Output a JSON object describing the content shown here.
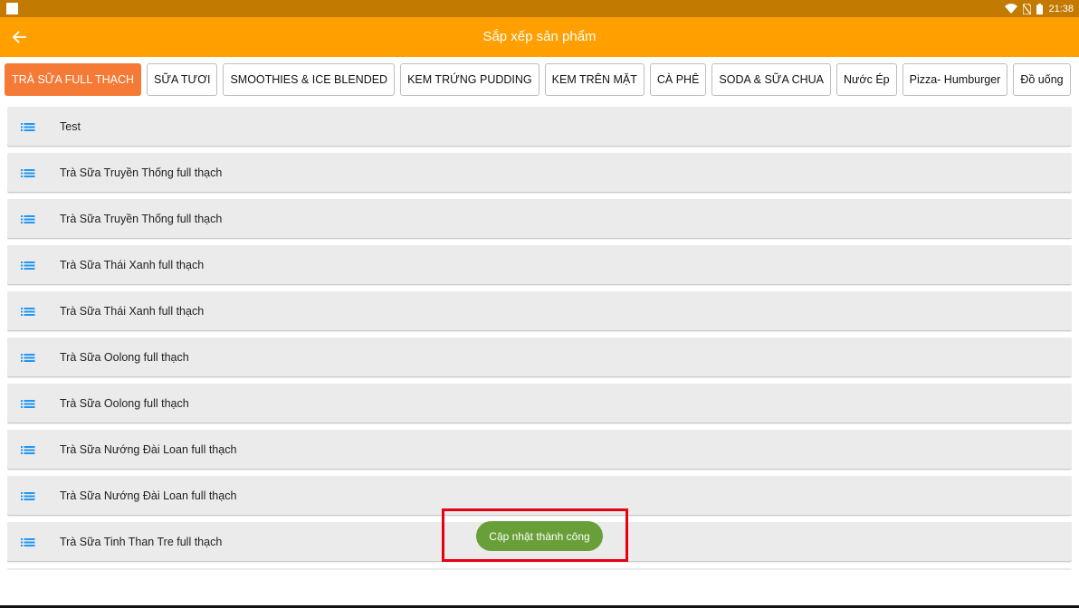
{
  "status_bar": {
    "time": "21:38",
    "icons": [
      "notification-square-icon",
      "wifi-icon",
      "no-sim-icon",
      "battery-icon"
    ]
  },
  "app_bar": {
    "title": "Sắp xếp sản phẩm",
    "back_icon": "arrow-left-icon",
    "background": "#ffa000"
  },
  "tabs": [
    {
      "label": "TRÀ SỮA FULL THẠCH",
      "selected": true
    },
    {
      "label": "SỮA TƯƠI",
      "selected": false
    },
    {
      "label": "SMOOTHIES & ICE BLENDED",
      "selected": false
    },
    {
      "label": "KEM TRỨNG PUDDING",
      "selected": false
    },
    {
      "label": "KEM TRÊN MẶT",
      "selected": false
    },
    {
      "label": "CÀ PHÊ",
      "selected": false
    },
    {
      "label": "SODA & SỮA CHUA",
      "selected": false
    },
    {
      "label": "Nước Ép",
      "selected": false
    },
    {
      "label": "Pizza- Humburger",
      "selected": false
    },
    {
      "label": "Đồ uống",
      "selected": false
    }
  ],
  "items": [
    {
      "label": "Test"
    },
    {
      "label": "Trà Sữa Truyền Thống full thạch"
    },
    {
      "label": "Trà Sữa Truyền Thống full thạch"
    },
    {
      "label": "Trà Sữa Thái Xanh full thạch"
    },
    {
      "label": "Trà Sữa Thái Xanh full thạch"
    },
    {
      "label": "Trà Sữa Oolong full thạch"
    },
    {
      "label": "Trà Sữa Oolong full thạch"
    },
    {
      "label": "Trà Sữa Nướng Đài Loan full thạch"
    },
    {
      "label": "Trà Sữa Nướng Đài Loan full thạch"
    },
    {
      "label": "Trà Sữa Tinh Than Tre full thạch"
    }
  ],
  "drag_icon": "reorder-list-icon",
  "toast": {
    "message": "Cập nhật thành công",
    "color": "#689f38"
  },
  "colors": {
    "accent": "#f47a36",
    "highlight": "#e60012",
    "handle": "#2196f3"
  }
}
